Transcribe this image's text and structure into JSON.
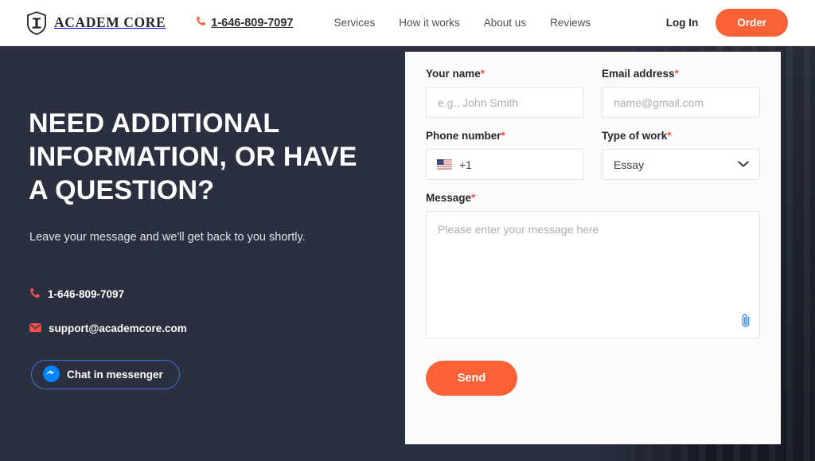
{
  "header": {
    "brand_name": "ACADEM CORE",
    "brand_icon": "shield-column-logo-icon",
    "phone": "1-646-809-7097",
    "phone_icon": "phone-icon",
    "nav": [
      {
        "label": "Services"
      },
      {
        "label": "How it works"
      },
      {
        "label": "About us"
      },
      {
        "label": "Reviews"
      }
    ],
    "login_label": "Log In",
    "order_label": "Order",
    "accent_color": "#fa6136"
  },
  "hero": {
    "title": "NEED ADDITIONAL INFORMATION, OR HAVE A QUESTION?",
    "subtitle": "Leave your message and we'll get back to you shortly.",
    "phone": "1-646-809-7097",
    "phone_icon": "phone-icon",
    "email": "support@academcore.com",
    "email_icon": "envelope-icon",
    "messenger_label": "Chat in messenger",
    "messenger_icon": "facebook-messenger-icon",
    "background_color": "#2b3040",
    "messenger_border_color": "#3b6fd4",
    "contact_icon_color": "#f4514e"
  },
  "form": {
    "name": {
      "label": "Your name",
      "required_mark": "*",
      "placeholder": "e.g., John Smith",
      "value": ""
    },
    "email": {
      "label": "Email address",
      "required_mark": "*",
      "placeholder": "name@gmail.com",
      "value": ""
    },
    "phone": {
      "label": "Phone number",
      "required_mark": "*",
      "country_flag": "us-flag-icon",
      "country_code": "+1",
      "value": ""
    },
    "work_type": {
      "label": "Type of work",
      "required_mark": "*",
      "selected": "Essay",
      "chevron_icon": "chevron-down-icon"
    },
    "message": {
      "label": "Message",
      "required_mark": "*",
      "placeholder": "Please enter your message here",
      "value": "",
      "attach_icon": "paperclip-icon"
    },
    "submit_label": "Send",
    "required_color": "#f4514e",
    "submit_color": "#fa6136"
  }
}
